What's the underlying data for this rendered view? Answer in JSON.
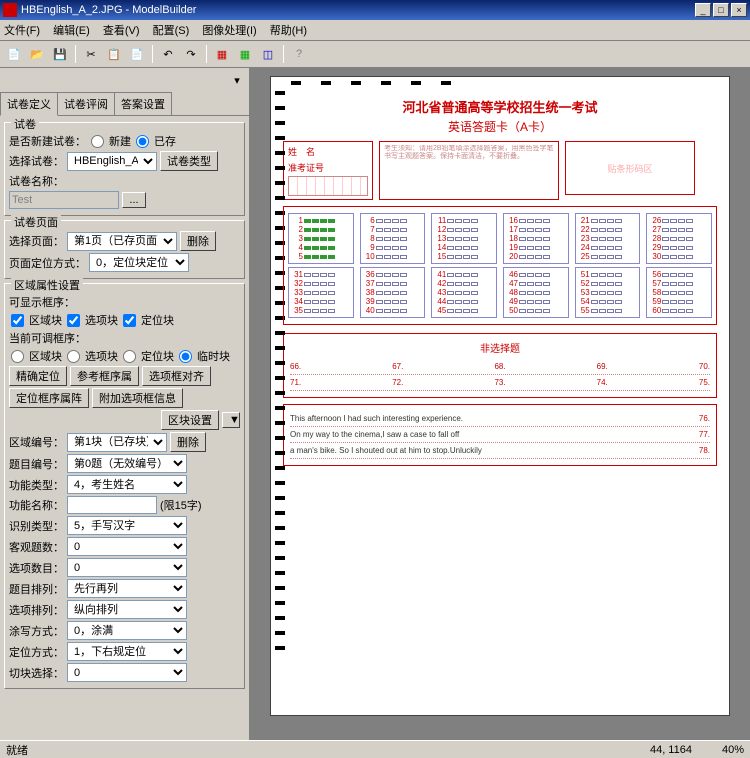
{
  "window": {
    "title": "HBEnglish_A_2.JPG - ModelBuilder",
    "min": "_",
    "max": "□",
    "close": "×"
  },
  "menu": [
    "文件(F)",
    "编辑(E)",
    "查看(V)",
    "配置(S)",
    "图像处理(I)",
    "帮助(H)"
  ],
  "tabs": [
    "试卷定义",
    "试卷评阅",
    "答案设置"
  ],
  "g1": {
    "title": "试卷",
    "lblNew": "是否新建试卷：",
    "rNew": "新建",
    "rExist": "已存",
    "lblSel": "选择试卷：",
    "selVal": "HBEnglish_A",
    "btnType": "试卷类型",
    "lblName": "试卷名称：",
    "nameVal": "Test",
    "dots": "..."
  },
  "g2": {
    "title": "试卷页面",
    "lblPage": "选择页面：",
    "pageVal": "第1页（已存页面）",
    "btnDel": "删除",
    "lblLoc": "页面定位方式：",
    "locVal": "0，定位块定位"
  },
  "g3": {
    "title": "区域属性设置",
    "lblShow": "可显示框序：",
    "c1": "区域块",
    "c2": "选项块",
    "c3": "定位块",
    "lblEdit": "当前可调框序：",
    "r1": "区域块",
    "r2": "选项块",
    "r3": "定位块",
    "r4": "临时块",
    "b1": "精确定位",
    "b2": "参考框序属",
    "b3": "选项框对齐",
    "b4": "定位框序属阵",
    "b5": "附加选项框信息",
    "btnCfg": "区块设置",
    "dd": "▼",
    "lblBlk": "区域编号：",
    "blkVal": "第1块（已存块）",
    "btnDel2": "删除",
    "lblQ": "题目编号：",
    "qVal": "第0题（无效编号）",
    "lblFn": "功能类型：",
    "fnVal": "4，考生姓名",
    "lblFnN": "功能名称：",
    "fnNVal": "",
    "hint": "(限15字)",
    "lblRec": "识别类型：",
    "recVal": "5，手写汉字",
    "lblObj": "客观题数：",
    "objVal": "0",
    "lblOpt": "选项数目：",
    "optVal": "0",
    "lblArr": "题目排列：",
    "arrVal": "先行再列",
    "lblSArr": "选项排列：",
    "sArrVal": "纵向排列",
    "lblFill": "涂写方式：",
    "fillVal": "0，涂满",
    "lblLoc2": "定位方式：",
    "loc2Val": "1，下右规定位",
    "lblCut": "切块选择：",
    "cutVal": "0"
  },
  "sheet": {
    "title": "河北省普通高等学校招生统一考试",
    "sub": "英语答题卡（A卡）",
    "nameL": "姓　名",
    "idL": "准考证号",
    "stamp": "贴条形码区",
    "essayTitle": "非选择题",
    "essayRows": [
      [
        "66.",
        "67.",
        "68.",
        "69.",
        "70."
      ],
      [
        "71.",
        "72.",
        "73.",
        "74.",
        "75."
      ]
    ],
    "writing": [
      "This afternoon I had such interesting experience.",
      "On my way to the cinema,I saw a case to fall off",
      "a man's bike. So I shouted out at him to stop.Unluckily"
    ],
    "wnums": [
      "76.",
      "77.",
      "78."
    ]
  },
  "status": {
    "ready": "就绪",
    "coords": "44, 1164",
    "zoom": "40%"
  }
}
